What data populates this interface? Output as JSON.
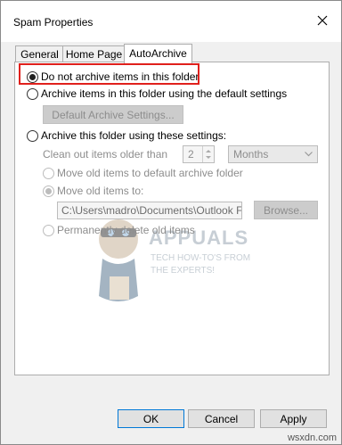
{
  "window": {
    "title": "Spam Properties"
  },
  "tabs": [
    {
      "label": "General"
    },
    {
      "label": "Home Page"
    },
    {
      "label": "AutoArchive"
    }
  ],
  "options": {
    "no_archive": "Do not archive items in this folder",
    "default_settings": "Archive items in this folder using the default settings",
    "default_archive_button": "Default Archive Settings...",
    "custom_settings": "Archive this folder using these settings:",
    "clean_out_label": "Clean out items older than",
    "clean_out_value": "2",
    "period_unit": "Months",
    "move_default": "Move old items to default archive folder",
    "move_to": "Move old items to:",
    "path": "C:\\Users\\madro\\Documents\\Outlook Fil",
    "browse": "Browse...",
    "delete": "Permanently delete old items"
  },
  "watermark": {
    "brand": "APPUALS",
    "tagline_1": "TECH HOW-TO'S FROM",
    "tagline_2": "THE EXPERTS!"
  },
  "buttons": {
    "ok": "OK",
    "cancel": "Cancel",
    "apply": "Apply"
  },
  "footer": {
    "site": "wsxdn.com"
  },
  "colors": {
    "highlight": "#e0201c",
    "accent": "#0078d7"
  }
}
